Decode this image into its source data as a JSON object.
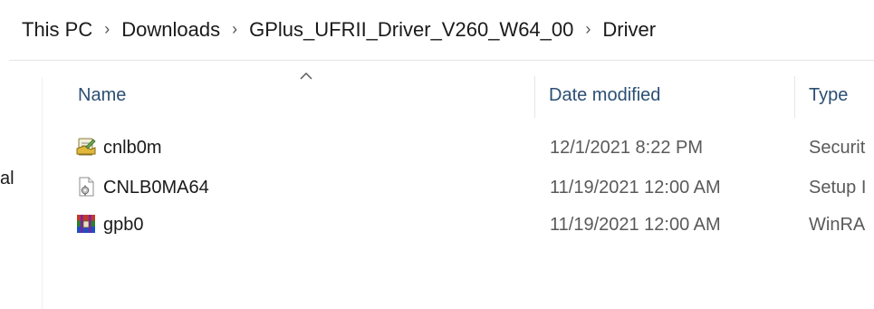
{
  "breadcrumb": [
    "This PC",
    "Downloads",
    "GPlus_UFRII_Driver_V260_W64_00",
    "Driver"
  ],
  "breadcrumb_separator": "›",
  "nav_pane": {
    "partial_label": "al"
  },
  "columns": {
    "name": "Name",
    "date_modified": "Date modified",
    "type": "Type"
  },
  "sort": {
    "column": "name",
    "direction": "ascending"
  },
  "files": [
    {
      "name": "cnlb0m",
      "date_modified": "12/1/2021 8:22 PM",
      "type": "Securit",
      "icon": "security-catalog-icon"
    },
    {
      "name": "CNLB0MA64",
      "date_modified": "11/19/2021 12:00 AM",
      "type": "Setup I",
      "icon": "setup-information-icon"
    },
    {
      "name": "gpb0",
      "date_modified": "11/19/2021 12:00 AM",
      "type": "WinRA",
      "icon": "winrar-archive-icon"
    }
  ]
}
